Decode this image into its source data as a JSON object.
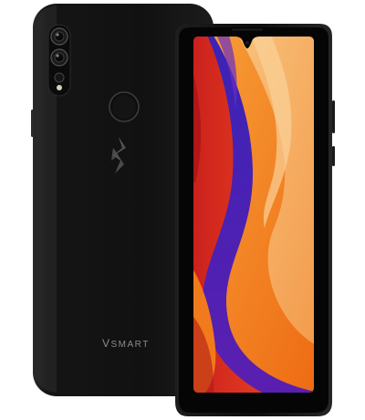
{
  "product": {
    "brand_wordmark": "VSMART",
    "brand_wordmark_first": "V",
    "brand_wordmark_rest": "SMART"
  },
  "icons": {
    "camera_module": "triple-camera-icon",
    "fingerprint": "fingerprint-sensor-icon",
    "logo": "vsmart-logo-icon",
    "notch": "waterdrop-notch-icon"
  },
  "colors": {
    "body": "#121212",
    "bezel": "#0a0a0a",
    "wallpaper_orange": "#f07a1c",
    "wallpaper_red": "#d92a1e",
    "wallpaper_purple": "#4a1fa8",
    "wallpaper_violet": "#6a2ec4",
    "wallpaper_peach": "#f5b06a",
    "logo_gray": "#5a5a5a"
  }
}
